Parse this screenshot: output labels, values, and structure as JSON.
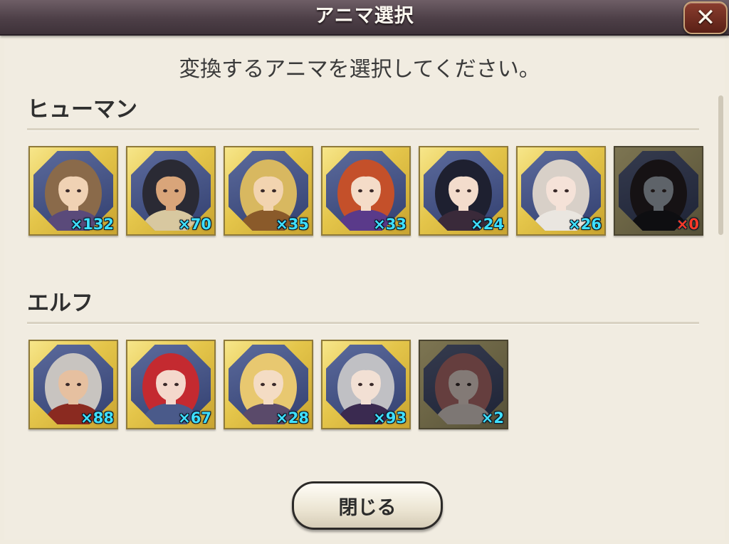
{
  "header": {
    "title": "アニマ選択",
    "close_glyph": "✕"
  },
  "instruction": "変換するアニマを選択してください。",
  "sections": [
    {
      "title": "ヒューマン",
      "animas": [
        {
          "count": "×132",
          "hair": "#8a6a4a",
          "skin": "#f0d2b4",
          "cloth": "#5a4a7a",
          "depleted": false
        },
        {
          "count": "×70",
          "hair": "#2a2a34",
          "skin": "#d9a57a",
          "cloth": "#d8c8a0",
          "depleted": false
        },
        {
          "count": "×35",
          "hair": "#d8b860",
          "skin": "#f2d4b0",
          "cloth": "#8a5a2a",
          "depleted": false
        },
        {
          "count": "×33",
          "hair": "#c4502a",
          "skin": "#f4dcc8",
          "cloth": "#5a3a8a",
          "depleted": false
        },
        {
          "count": "×24",
          "hair": "#1e2030",
          "skin": "#f3dccc",
          "cloth": "#3a2a3a",
          "depleted": false
        },
        {
          "count": "×26",
          "hair": "#d8d0c8",
          "skin": "#f5e2d8",
          "cloth": "#eae6e0",
          "depleted": false
        },
        {
          "count": "×0",
          "hair": "#2a2026",
          "skin": "#a8b4c4",
          "cloth": "#1a1a22",
          "depleted": true
        }
      ]
    },
    {
      "title": "エルフ",
      "animas": [
        {
          "count": "×88",
          "hair": "#c8c4c0",
          "skin": "#e6c0a0",
          "cloth": "#8a2a20",
          "depleted": false
        },
        {
          "count": "×67",
          "hair": "#c42a30",
          "skin": "#f4d8cc",
          "cloth": "#4a5a8a",
          "depleted": false
        },
        {
          "count": "×28",
          "hair": "#e8c870",
          "skin": "#f4dcc4",
          "cloth": "#5a4a6a",
          "depleted": false
        },
        {
          "count": "×93",
          "hair": "#c0c0c4",
          "skin": "#f2e0d4",
          "cloth": "#3a2a50",
          "depleted": false
        },
        {
          "count": "×2",
          "hair": "#d06a6a",
          "skin": "#f5dcd2",
          "cloth": "#e8d8d0",
          "depleted": true
        }
      ]
    }
  ],
  "footer": {
    "close_label": "閉じる"
  }
}
